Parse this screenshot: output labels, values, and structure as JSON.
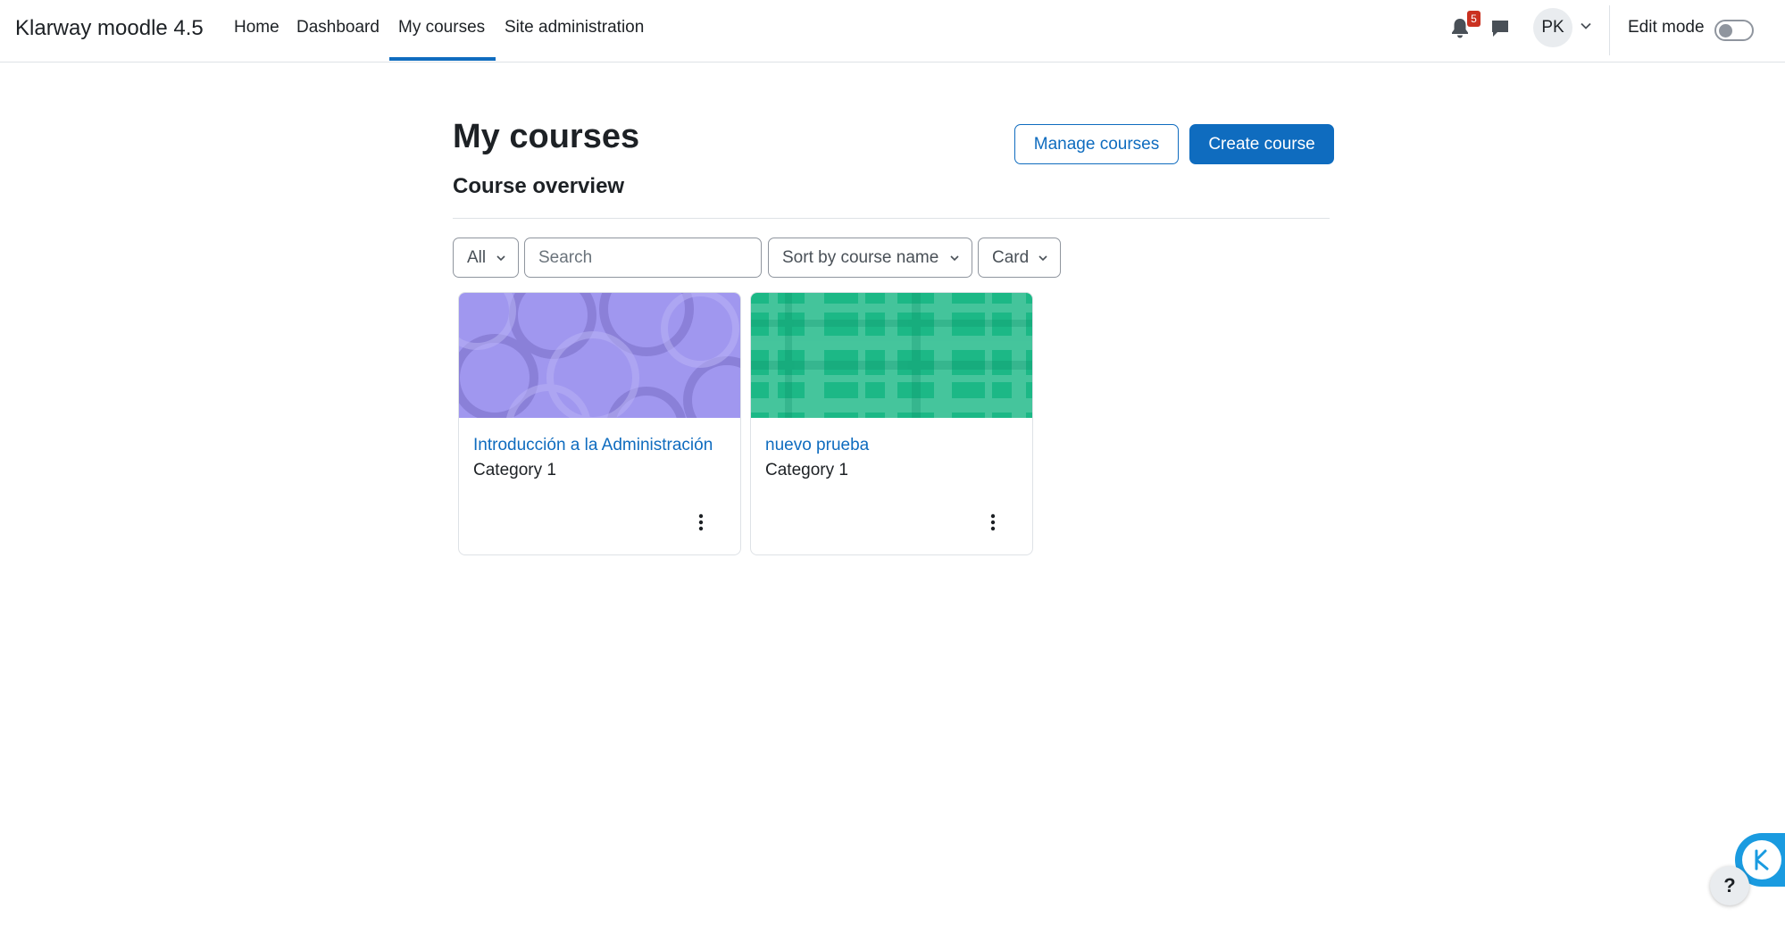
{
  "navbar": {
    "brand": "Klarway moodle 4.5",
    "links": [
      {
        "label": "Home"
      },
      {
        "label": "Dashboard"
      },
      {
        "label": "My courses",
        "active": true
      },
      {
        "label": "Site administration"
      }
    ],
    "notifications_count": "5",
    "user_initials": "PK",
    "edit_mode_label": "Edit mode",
    "edit_mode_on": false,
    "accent_color": "#0f6cbf"
  },
  "page": {
    "title": "My courses",
    "manage_courses_label": "Manage courses",
    "create_course_label": "Create course",
    "section_title": "Course overview"
  },
  "filters": {
    "grouping": "All",
    "search_placeholder": "Search",
    "sort": "Sort by course name",
    "view": "Card"
  },
  "courses": [
    {
      "name": "Introducción a la Administración",
      "category": "Category 1",
      "image_color": "#a097ef"
    },
    {
      "name": "nuevo prueba",
      "category": "Category 1",
      "image_color": "#1cb886"
    }
  ],
  "widgets": {
    "help_label": "?",
    "klarway_icon": "klarway-logo-icon"
  }
}
